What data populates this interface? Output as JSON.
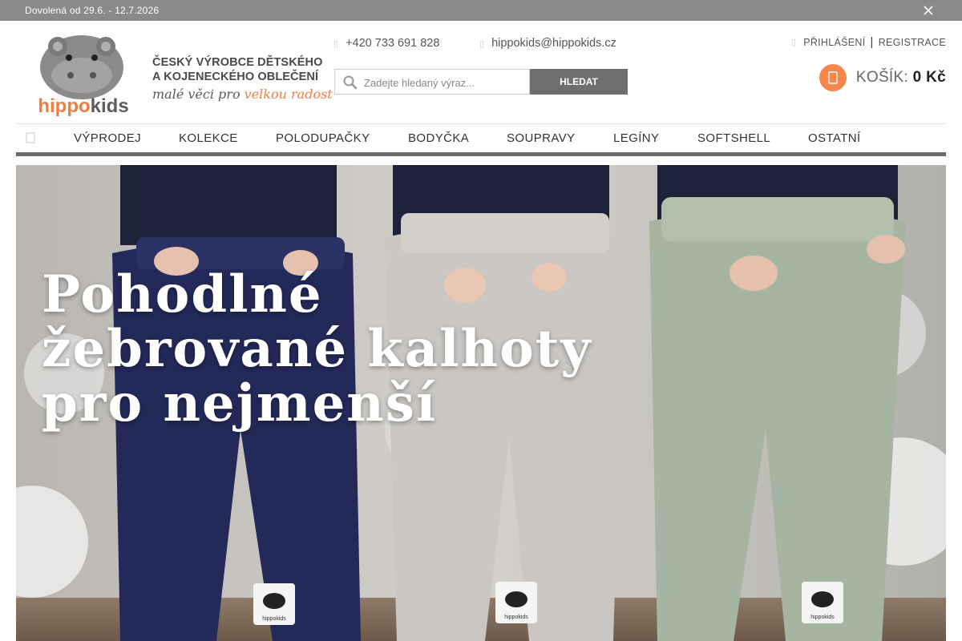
{
  "notice": {
    "text": "Dovolená od 29.6. - 12.7.2026",
    "close_icon": "close-icon"
  },
  "brand": {
    "logo_text": "hippokids",
    "tagline_line1": "ČESKÝ VÝROBCE DĚTSKÉHO",
    "tagline_line2": "A KOJENECKÉHO OBLEČENÍ",
    "tagline_slogan_a": "malé věci pro ",
    "tagline_slogan_b": "velkou radost",
    "accent_color": "#f4874b"
  },
  "contact": {
    "phone_icon": "phone-icon",
    "phone": "+420 733 691 828",
    "email_icon": "mail-icon",
    "email": "hippokids@hippokids.cz"
  },
  "search": {
    "placeholder": "Zadejte hledaný výraz...",
    "button_label": "HLEDAT"
  },
  "account": {
    "login": "PŘIHLÁŠENÍ",
    "separator": "|",
    "register": "REGISTRACE"
  },
  "cart": {
    "label": "KOŠÍK:",
    "total": "0 Kč"
  },
  "nav": {
    "home_icon": "home-icon",
    "items": [
      {
        "label": "VÝPRODEJ"
      },
      {
        "label": "KOLEKCE"
      },
      {
        "label": "POLODUPAČKY"
      },
      {
        "label": "BODYČKA"
      },
      {
        "label": "SOUPRAVY"
      },
      {
        "label": "LEGÍNY"
      },
      {
        "label": "SOFTSHELL"
      },
      {
        "label": "OSTATNÍ"
      }
    ]
  },
  "hero": {
    "line1": "Pohodlné",
    "line2": "žebrované kalhoty",
    "line3": "pro nejmenší",
    "patch_label": "hippokids"
  }
}
